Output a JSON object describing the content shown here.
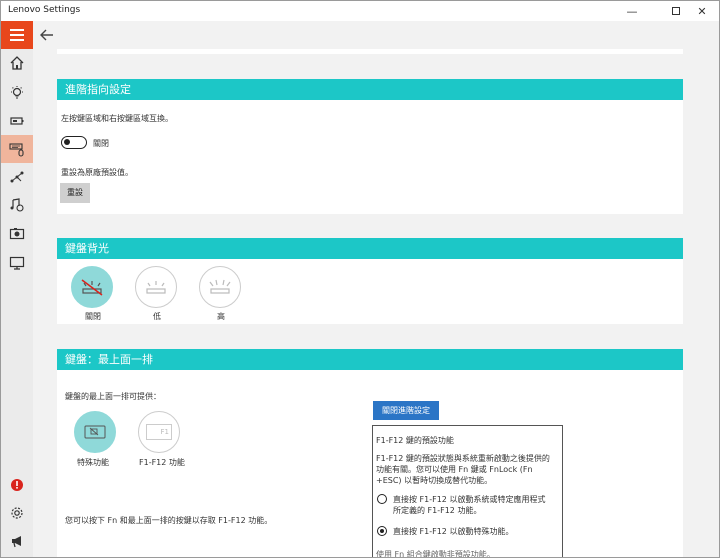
{
  "window": {
    "title": "Lenovo Settings",
    "min_symbol": "—",
    "close_symbol": "✕"
  },
  "sidebar": {
    "items": [
      {
        "name": "home-icon"
      },
      {
        "name": "lightbulb-icon"
      },
      {
        "name": "battery-icon"
      },
      {
        "name": "keyboard-mouse-icon",
        "active": true
      },
      {
        "name": "network-icon"
      },
      {
        "name": "audio-icon"
      },
      {
        "name": "camera-icon"
      },
      {
        "name": "display-icon"
      }
    ],
    "bottom_items": [
      {
        "name": "alert-icon"
      },
      {
        "name": "gear-icon"
      },
      {
        "name": "megaphone-icon"
      }
    ]
  },
  "advanced": {
    "title": "進階指向設定",
    "swap_label": "左按鍵區域和右按鍵區域互換。",
    "toggle_state": "關閉",
    "reset_desc": "重設為原廠預設值。",
    "reset_button": "重設"
  },
  "backlight": {
    "title": "鍵盤背光",
    "options": [
      {
        "label": "關閉",
        "selected": true
      },
      {
        "label": "低",
        "selected": false
      },
      {
        "label": "高",
        "selected": false
      }
    ]
  },
  "toprow": {
    "title": "鍵盤：最上面一排",
    "desc": "鍵盤的最上面一排可提供：",
    "options": [
      {
        "label": "特殊功能",
        "selected": true
      },
      {
        "label": "F1-F12 功能",
        "selected": false
      }
    ],
    "fkey_icon_text": "F1",
    "footer": "您可以按下 Fn 和最上面一排的按鍵以存取 F1-F12 功能。",
    "close_advanced_button": "關閉進階設定",
    "info": {
      "heading": "F1-F12 鍵的預設功能",
      "para_line1": "F1-F12 鍵的預設狀態與系統重新啟動之後提供的",
      "para_line2": "功能有關。您可以使用 Fn 鍵或 FnLock (Fn",
      "para_line3": "+ESC) 以暫時切換成替代功能。",
      "radio1_line1": "直接按 F1-F12 以啟動系統或特定應用程式",
      "radio1_line2": "所定義的 F1-F12 功能。",
      "radio2": "直接按 F1-F12 以啟動特殊功能。",
      "cutoff": "使用 Fn 組合鍵啟動非預設功能。"
    }
  }
}
